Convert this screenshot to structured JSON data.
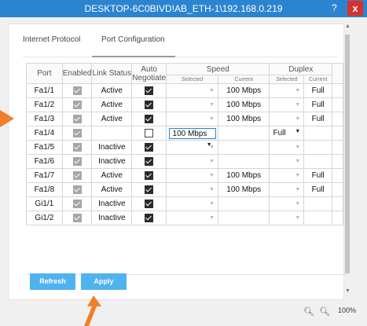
{
  "window": {
    "title": "DESKTOP-6C0BIVD!AB_ETH-1\\192.168.0.219",
    "help": "?",
    "close": "x"
  },
  "tabs": [
    {
      "label": "Internet Protocol",
      "active": false
    },
    {
      "label": "Port Configuration",
      "active": true
    }
  ],
  "table": {
    "headers": {
      "port": "Port",
      "enabled": "Enabled",
      "link_status": "Link Status",
      "auto_negotiate": "Auto Negotiate",
      "speed": "Speed",
      "duplex": "Duplex",
      "selected": "Selected",
      "current": "Current"
    },
    "rows": [
      {
        "port": "Fa1/1",
        "enabled": true,
        "link_status": "Active",
        "auto": true,
        "speed_selected": "",
        "speed_current": "100 Mbps",
        "duplex_selected": "",
        "duplex_current": "Full"
      },
      {
        "port": "Fa1/2",
        "enabled": true,
        "link_status": "Active",
        "auto": true,
        "speed_selected": "",
        "speed_current": "100 Mbps",
        "duplex_selected": "",
        "duplex_current": "Full"
      },
      {
        "port": "Fa1/3",
        "enabled": true,
        "link_status": "Active",
        "auto": true,
        "speed_selected": "",
        "speed_current": "100 Mbps",
        "duplex_selected": "",
        "duplex_current": "Full"
      },
      {
        "port": "Fa1/4",
        "enabled": true,
        "link_status": "",
        "auto": false,
        "speed_selected": "100 Mbps",
        "speed_current": "",
        "duplex_selected": "Full",
        "duplex_current": ""
      },
      {
        "port": "Fa1/5",
        "enabled": true,
        "link_status": "Inactive",
        "auto": true,
        "speed_selected": "",
        "speed_current": "",
        "duplex_selected": "",
        "duplex_current": ""
      },
      {
        "port": "Fa1/6",
        "enabled": true,
        "link_status": "Inactive",
        "auto": true,
        "speed_selected": "",
        "speed_current": "",
        "duplex_selected": "",
        "duplex_current": ""
      },
      {
        "port": "Fa1/7",
        "enabled": true,
        "link_status": "Active",
        "auto": true,
        "speed_selected": "",
        "speed_current": "100 Mbps",
        "duplex_selected": "",
        "duplex_current": "Full"
      },
      {
        "port": "Fa1/8",
        "enabled": true,
        "link_status": "Active",
        "auto": true,
        "speed_selected": "",
        "speed_current": "100 Mbps",
        "duplex_selected": "",
        "duplex_current": "Full"
      },
      {
        "port": "Gi1/1",
        "enabled": true,
        "link_status": "Inactive",
        "auto": true,
        "speed_selected": "",
        "speed_current": "",
        "duplex_selected": "",
        "duplex_current": ""
      },
      {
        "port": "Gi1/2",
        "enabled": true,
        "link_status": "Inactive",
        "auto": true,
        "speed_selected": "",
        "speed_current": "",
        "duplex_selected": "",
        "duplex_current": ""
      }
    ]
  },
  "buttons": {
    "refresh": "Refresh",
    "apply": "Apply"
  },
  "zoom": {
    "level": "100%",
    "zoom_in_icon": "zoom-in-icon",
    "zoom_out_icon": "zoom-out-icon"
  },
  "colors": {
    "titlebar": "#2b84d0",
    "close": "#d9302b",
    "button": "#4fb3ef",
    "annotation_arrow": "#f07f2a"
  }
}
